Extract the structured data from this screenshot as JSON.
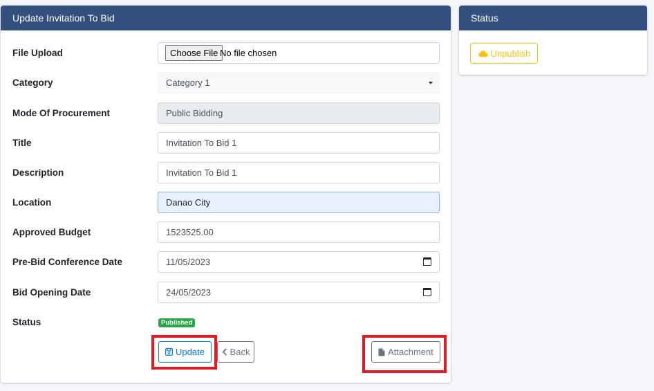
{
  "main_card": {
    "title": "Update Invitation To Bid",
    "file_upload": {
      "label": "File Upload",
      "button": "Choose File",
      "value": "No file chosen"
    },
    "category": {
      "label": "Category",
      "value": "Category 1"
    },
    "mode": {
      "label": "Mode Of Procurement",
      "value": "Public Bidding"
    },
    "title_field": {
      "label": "Title",
      "value": "Invitation To Bid 1"
    },
    "description": {
      "label": "Description",
      "value": "Invitation To Bid 1"
    },
    "location": {
      "label": "Location",
      "value": "Danao City"
    },
    "budget": {
      "label": "Approved Budget",
      "value": "1523525.00"
    },
    "prebid": {
      "label": "Pre-Bid Conference Date",
      "value": "11/05/2023"
    },
    "bid_opening": {
      "label": "Bid Opening Date",
      "value": "24/05/2023"
    },
    "status": {
      "label": "Status",
      "badge": "Published"
    },
    "buttons": {
      "update": "Update",
      "back": "Back",
      "attachment": "Attachment"
    }
  },
  "status_card": {
    "title": "Status",
    "unpublish": "Unpublish"
  },
  "icons": {
    "update": "save-icon",
    "back": "chevron-left-icon",
    "attachment": "file-icon",
    "unpublish": "cloud-icon",
    "date": "calendar-icon",
    "select": "caret-down-icon"
  },
  "colors": {
    "header": "#34507e",
    "primary": "#007bff",
    "secondary": "#6c757d",
    "warning": "#ffc107",
    "success": "#28a745",
    "highlight": "#e01b24"
  }
}
